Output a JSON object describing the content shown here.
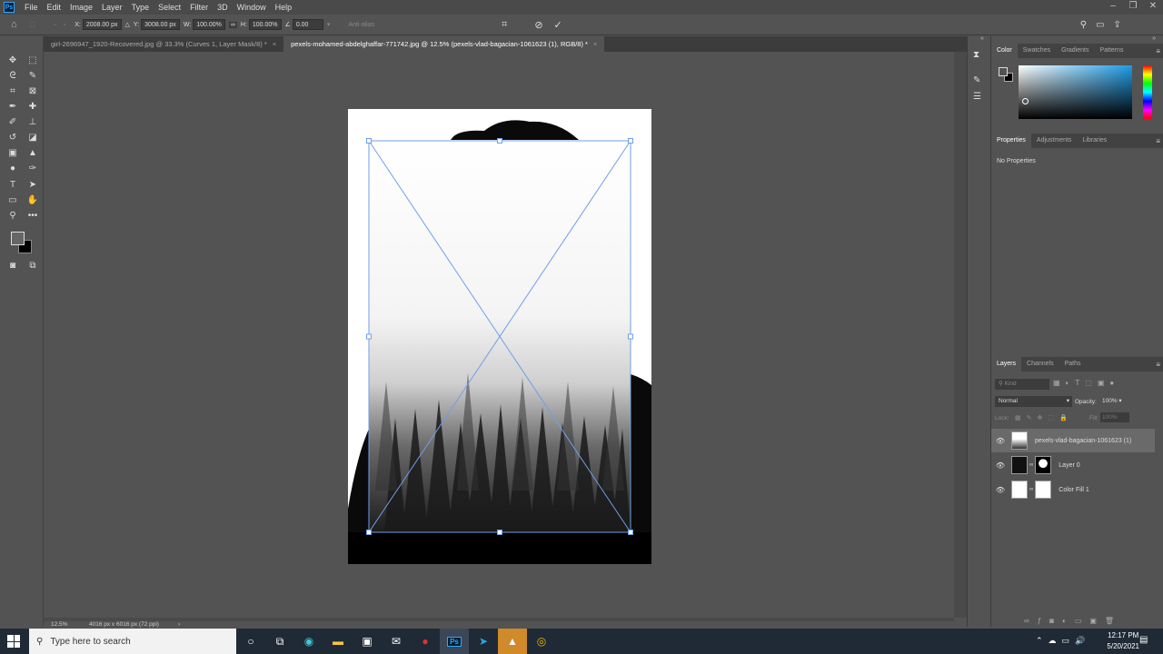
{
  "menubar": {
    "app_logo": "Ps",
    "items": [
      "File",
      "Edit",
      "Image",
      "Layer",
      "Type",
      "Select",
      "Filter",
      "3D",
      "Window",
      "Help"
    ]
  },
  "optionsbar": {
    "x_label": "X:",
    "x_value": "2008.00 px",
    "y_label": "Y:",
    "y_value": "3008.00 px",
    "w_label": "W:",
    "w_value": "100.00%",
    "h_label": "H:",
    "h_value": "100.00%",
    "angle_value": "0.00",
    "antialias_label": "Anti-alias"
  },
  "tabs": [
    {
      "label": "girl-2696947_1920-Recovered.jpg @ 33.3% (Curves 1, Layer Mask/8) *"
    },
    {
      "label": "pexels-mohamed-abdelghaffar-771742.jpg @ 12.5% (pexels-vlad-bagacian-1061623 (1), RGB/8) *"
    }
  ],
  "statusbar": {
    "zoom": "12.5%",
    "doc_info": "4016 px x 6016 px (72 ppi)"
  },
  "color_panel": {
    "tabs": [
      "Color",
      "Swatches",
      "Gradients",
      "Patterns"
    ]
  },
  "properties_panel": {
    "tabs": [
      "Properties",
      "Adjustments",
      "Libraries"
    ],
    "empty_text": "No Properties"
  },
  "layers_panel": {
    "tabs": [
      "Layers",
      "Channels",
      "Paths"
    ],
    "filter_placeholder": "Kind",
    "blend_mode": "Normal",
    "opacity_label": "Opacity:",
    "opacity_value": "100%",
    "lock_label": "Lock:",
    "fill_label": "Fill:",
    "fill_value": "100%",
    "layers": [
      {
        "name": "pexels-vlad-bagacian-1061623 (1)",
        "selected": true
      },
      {
        "name": "Layer 0",
        "selected": false
      },
      {
        "name": "Color Fill 1",
        "selected": false
      }
    ]
  },
  "taskbar": {
    "search_placeholder": "Type here to search",
    "time": "12:17 PM",
    "date": "5/20/2021"
  },
  "colors": {
    "transform_box": "#6f9fe8",
    "accent": "#31a8ff"
  }
}
